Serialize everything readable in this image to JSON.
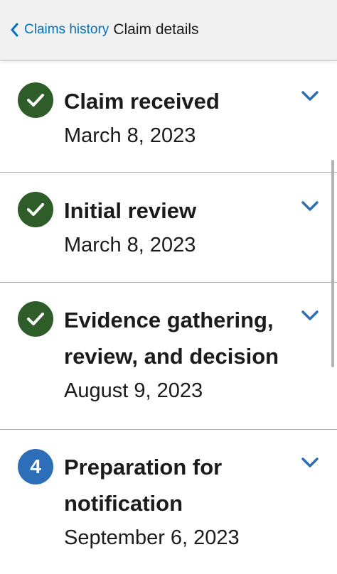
{
  "header": {
    "back_label": "Claims history",
    "title": "Claim details"
  },
  "colors": {
    "complete": "#2e5d2a",
    "current": "#2c6fb8",
    "link": "#0071bb"
  },
  "steps": [
    {
      "title": "Claim received",
      "date": "March 8, 2023",
      "status": "complete",
      "icon": "check-icon"
    },
    {
      "title": "Initial review",
      "date": "March 8, 2023",
      "status": "complete",
      "icon": "check-icon"
    },
    {
      "title": "Evidence gathering, review, and decision",
      "date": "August 9, 2023",
      "status": "complete",
      "icon": "check-icon"
    },
    {
      "title": "Preparation for notification",
      "date": "September 6, 2023",
      "status": "current",
      "number": "4"
    }
  ]
}
